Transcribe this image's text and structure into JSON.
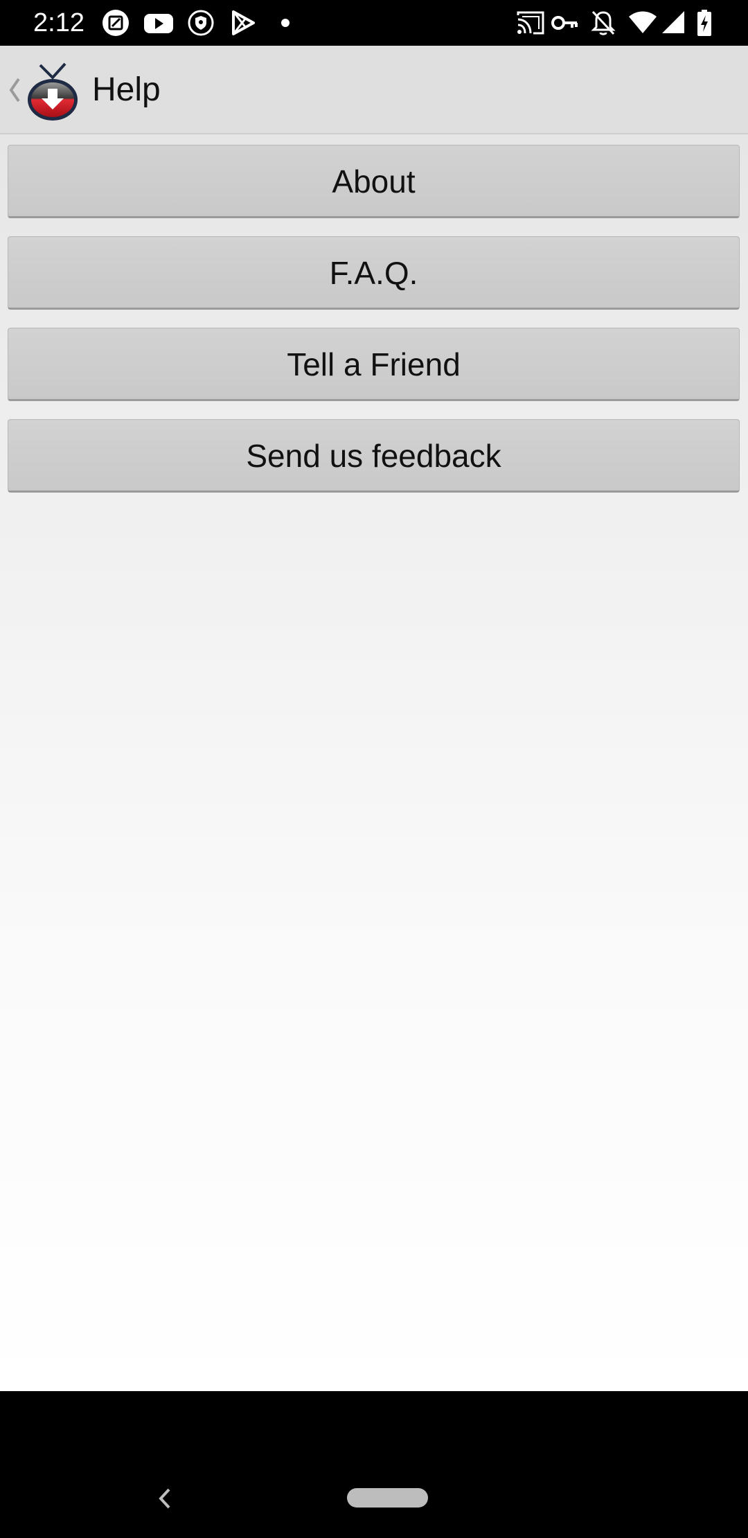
{
  "status_bar": {
    "time": "2:12",
    "left_icons": [
      "edit-square-icon",
      "youtube-icon",
      "shield-icon",
      "play-store-icon",
      "dot-icon"
    ],
    "right_icons": [
      "cast-icon",
      "vpn-key-icon",
      "notifications-off-icon",
      "wifi-icon",
      "signal-icon",
      "battery-charging-icon"
    ]
  },
  "app_bar": {
    "title": "Help",
    "logo_icon": "tv-download-icon",
    "up_icon": "up-caret-icon"
  },
  "menu": {
    "items": [
      {
        "label": "About"
      },
      {
        "label": "F.A.Q."
      },
      {
        "label": "Tell a Friend"
      },
      {
        "label": "Send us feedback"
      }
    ]
  },
  "nav_bar": {
    "back_icon": "back-icon",
    "home_icon": "home-pill-icon"
  },
  "colors": {
    "app_bar_bg": "#dfdfdf",
    "button_bg": "#cccccc",
    "logo_red": "#d9202a"
  }
}
